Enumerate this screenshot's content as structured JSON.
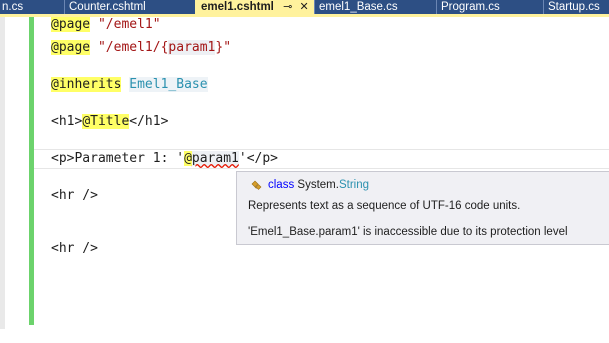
{
  "tabs": [
    {
      "label": "n.cs",
      "active": false
    },
    {
      "label": "Counter.cshtml",
      "active": false
    },
    {
      "label": "emel1.cshtml",
      "active": true,
      "pin": "⊸",
      "close": "✕"
    },
    {
      "label": "emel1_Base.cs",
      "active": false
    },
    {
      "label": "Program.cs",
      "active": false
    },
    {
      "label": "Startup.cs",
      "active": false
    }
  ],
  "code": {
    "l1_dir": "@page",
    "l1_str": "\"/emel1\"",
    "l2_dir": "@page",
    "l2_str_a": "\"/emel1/{",
    "l2_str_param": "param1",
    "l2_str_b": "}\"",
    "l4_dir": "@inherits",
    "l4_type": "Emel1_Base",
    "l6_open": "<h1>",
    "l6_at": "@Title",
    "l6_close": "</h1>",
    "l8_open": "<p>",
    "l8_text": "Parameter 1: '",
    "l8_at": "@",
    "l8_param": "param1",
    "l8_text2": "'",
    "l8_close": "</p>",
    "l10": "<hr />",
    "l13": "<hr />"
  },
  "tooltip": {
    "icon": "class-icon",
    "keyword": "class",
    "namespace": "System.",
    "type": "String",
    "description": "Represents text as a sequence of UTF-16 code units.",
    "error": "'Emel1_Base.param1' is inaccessible due to its protection level"
  },
  "colors": {
    "tab_active": "#fff29d",
    "tab_bar": "#2d4f84",
    "change_bar": "#6cd36c",
    "razor_highlight": "#ffff66",
    "error_squiggle": "#e51400"
  }
}
